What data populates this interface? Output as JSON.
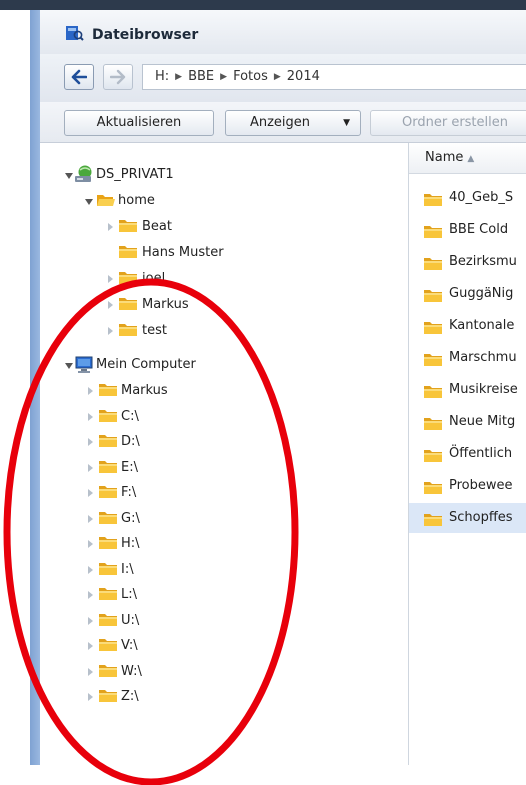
{
  "window": {
    "title": "Dateibrowser"
  },
  "nav": {
    "path": [
      "H:",
      "BBE",
      "Fotos",
      "2014"
    ]
  },
  "toolbar": {
    "refresh_label": "Aktualisieren",
    "view_label": "Anzeigen",
    "create_folder_label": "Ordner erstellen"
  },
  "tree": {
    "root1": {
      "label": "DS_PRIVAT1",
      "icon": "network-drive-icon"
    },
    "home": {
      "label": "home"
    },
    "home_children": [
      "Beat",
      "Hans Muster",
      "joel",
      "Markus",
      "test"
    ],
    "root2": {
      "label": "Mein Computer",
      "icon": "computer-icon"
    },
    "computer_children": [
      "Markus",
      "C:\\",
      "D:\\",
      "E:\\",
      "F:\\",
      "G:\\",
      "H:\\",
      "I:\\",
      "L:\\",
      "U:\\",
      "V:\\",
      "W:\\",
      "Z:\\"
    ]
  },
  "filelist": {
    "column_name": "Name",
    "rows": [
      "40_Geb_S",
      "BBE Cold",
      "Bezirksmu",
      "GuggäNig",
      "Kantonale",
      "Marschmu",
      "Musikreise",
      "Neue Mitg",
      "Öffentlich",
      "Probewee",
      "Schopffes"
    ],
    "selected_index": 10
  },
  "colors": {
    "accent": "#1f4f9a",
    "annotation": "#e8000b",
    "folder": "#f5b82a"
  }
}
